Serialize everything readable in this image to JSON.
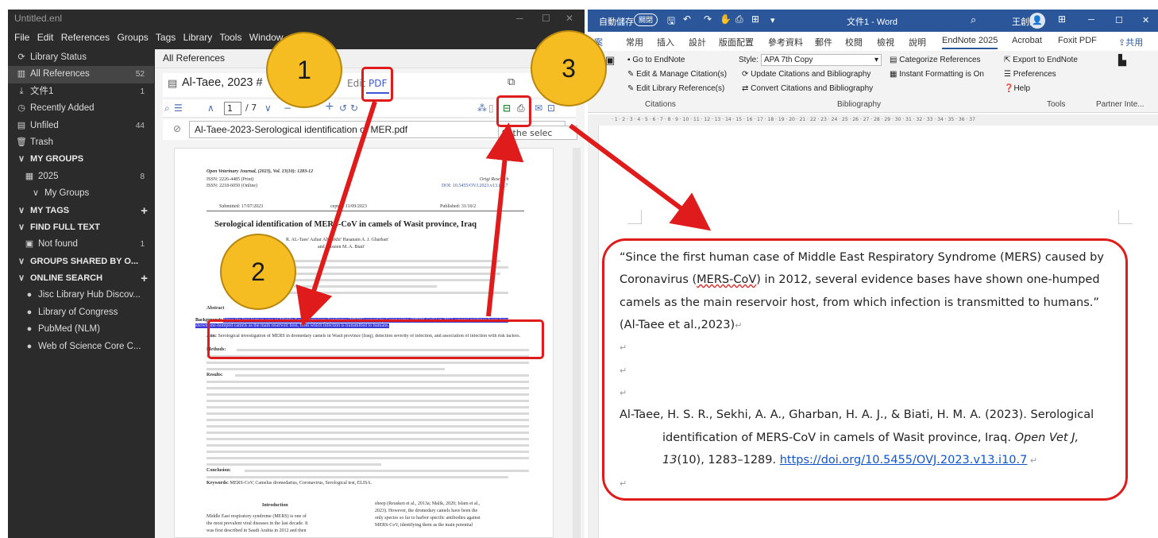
{
  "endnote": {
    "title": "Untitled.enl",
    "menu": [
      "File",
      "Edit",
      "References",
      "Groups",
      "Tags",
      "Library",
      "Tools",
      "Window"
    ],
    "sidebar": [
      {
        "label": "Library Status",
        "icon": "refresh-icon",
        "count": "",
        "kind": "item"
      },
      {
        "label": "All References",
        "icon": "library-icon",
        "count": "52",
        "kind": "item",
        "selected": true
      },
      {
        "label": "文件1",
        "icon": "import-icon",
        "count": "1",
        "kind": "item"
      },
      {
        "label": "Recently Added",
        "icon": "clock-icon",
        "count": "",
        "kind": "item"
      },
      {
        "label": "Unfiled",
        "icon": "unfiled-icon",
        "count": "44",
        "kind": "item"
      },
      {
        "label": "Trash",
        "icon": "trash-icon",
        "count": "",
        "kind": "item"
      },
      {
        "label": "MY GROUPS",
        "kind": "header"
      },
      {
        "label": "2025",
        "icon": "group-icon",
        "count": "8",
        "kind": "sub1"
      },
      {
        "label": "My Groups",
        "kind": "sub2"
      },
      {
        "label": "MY TAGS",
        "kind": "header",
        "plus": true
      },
      {
        "label": "FIND FULL TEXT",
        "kind": "header"
      },
      {
        "label": "Not found",
        "icon": "document-icon",
        "count": "1",
        "kind": "sub1"
      },
      {
        "label": "GROUPS SHARED BY O...",
        "kind": "header"
      },
      {
        "label": "ONLINE SEARCH",
        "kind": "header",
        "plus": true
      },
      {
        "label": "Jisc Library Hub Discov...",
        "icon": "globe-icon",
        "count": "",
        "kind": "sub1"
      },
      {
        "label": "Library of Congress",
        "icon": "globe-icon",
        "count": "",
        "kind": "sub1"
      },
      {
        "label": "PubMed (NLM)",
        "icon": "globe-icon",
        "count": "",
        "kind": "sub1"
      },
      {
        "label": "Web of Science Core C...",
        "icon": "globe-icon",
        "count": "",
        "kind": "sub1"
      }
    ],
    "all_refs_label": "All References",
    "ref_title": "Al-Taee, 2023 #",
    "tab_edit": "Edit",
    "tab_pdf": "PDF",
    "page_input": "1",
    "page_total": "/ 7",
    "pdf_filename": "Al-Taee-2023-Serological identification of MER.pdf",
    "tooltip": "ts the selec"
  },
  "pdf": {
    "journal": "Open Veterinary Journal, (2023), Vol. 13(10): 1283-12",
    "issn_print": "ISSN: 2226-4485 (Print)",
    "issn_online": "ISSN: 2218-6050 (Online)",
    "orig_research": "Origi Research",
    "doi": "DOI: 10.5455/OVJ.2023.v13.i10.7",
    "submitted": "Submitted: 17/07/2023",
    "accepted": "cepted: 11/09/2023",
    "published": "Published: 31/10/2",
    "title": "Serological identification of MERS-CoV in camels of Wasit province, Iraq",
    "authors_1": "R. AL-Taee' Azhar Ali Sekhi' Hasanain A. J. Gharban' ",
    "authors_2": "and Hussien M. A. Biati' ",
    "abstract_label": "Abstract",
    "background_label": "Background:",
    "background_text": "Since the first human case of Middle East Respiratory Syndrome (MERS) caused by Coronavirus (MERS-CoV) in 2012, several evidence bases have shown one-humped camels as the main reservoir host, from which infection is transmitted to humans.",
    "aim_label": "Aim:",
    "aim_text": "Serological investigation of MERS in dromedary camels in Wasit province (Iraq), detection severity of infection, and association of infection with risk factors.",
    "methods_label": "Methods:",
    "results_label": "Results:",
    "conclusion_label": "Conclusion:",
    "keywords_label": "Keywords:",
    "keywords_text": "MERS-CoV, Camelus dromedarius, Coronavirus, Serological test, ELISA.",
    "intro_heading": "Introduction",
    "intro_left_1": "Middle East respiratory syndrome (MERS) is one of",
    "intro_left_2": "the most prevalent viral diseases in the last decade. It",
    "intro_left_3": "was first described in Saudi Arabia in 2012 and then",
    "intro_right_1": "sheep (Reusken et al., 2013a; Malik, 2020; Islam et al.,",
    "intro_right_2": "2023). However, the dromedary camels have been the",
    "intro_right_3": "only species so far to harbor specific antibodies against",
    "intro_right_4": "MERS-CoV, identifying them as the main potential"
  },
  "word": {
    "autosave_label": "自動儲存",
    "autosave_toggle": "關閉",
    "doc_title": "文件1 - Word",
    "user_name": "王創生",
    "tabs": [
      "常用",
      "插入",
      "設計",
      "版面配置",
      "參考資料",
      "郵件",
      "校閱",
      "檢視",
      "說明",
      "EndNote 2025",
      "Acrobat",
      "Foxit PDF"
    ],
    "share": "共用",
    "ribbon": {
      "goto": "Go to EndNote",
      "edit_manage": "Edit & Manage Citation(s)",
      "edit_library": "Edit Library Reference(s)",
      "style_label": "Style:",
      "style_value": "APA 7th Copy",
      "update": "Update Citations and Bibliography",
      "convert": "Convert Citations and Bibliography",
      "categorize": "Categorize References",
      "instant": "Instant Formatting is On",
      "export": "Export to EndNote",
      "preferences": "Preferences",
      "help": "Help",
      "group_citations": "Citations",
      "group_bibliography": "Bibliography",
      "group_tools": "Tools",
      "group_partner": "Partner Inte..."
    },
    "doc": {
      "line1": "“Since the first human case of Middle East Respiratory Syndrome (MERS) caused by",
      "line2_pre": "Coronavirus (",
      "line2_mers": "MERS-CoV",
      "line2_post": ") in 2012, several evidence bases have shown one-humped",
      "line3": "camels as the main reservoir host, from which infection is transmitted to humans.”",
      "line4": "(Al-Taee et al.,2023)",
      "bib1": "Al-Taee, H. S. R., Sekhi, A. A., Gharban, H. A. J., & Biati, H. M. A. (2023). Serological",
      "bib2_pre": "identification of MERS-CoV in camels of Wasit province, Iraq. ",
      "bib2_journal": "Open Vet J,",
      "bib3_vol": "13",
      "bib3_pre": "(10), 1283–1289. ",
      "bib3_link": "https://doi.org/10.5455/OVJ.2023.v13.i10.7",
      "para_mark": "↵"
    }
  },
  "steps": [
    "1",
    "2",
    "3"
  ],
  "colors": {
    "annotation_red": "#e01b1b",
    "bubble": "#f5bd22",
    "word_blue": "#2b579a",
    "pdf_highlight": "#3a3ad6",
    "link": "#1155cc"
  }
}
